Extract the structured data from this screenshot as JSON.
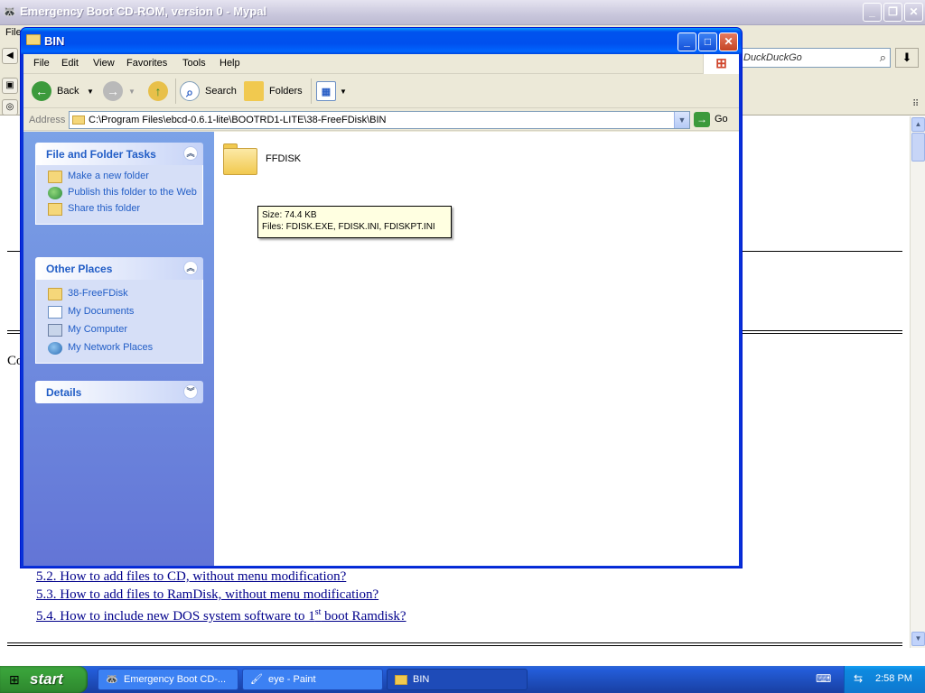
{
  "browser": {
    "title": "Emergency Boot CD-ROM, version 0 - Mypal",
    "menu_first": "File",
    "search_placeholder": "DuckDuckGo",
    "body_fragment": "Co",
    "toc_links": [
      {
        "text": "5.2. How to add files to CD, without menu modification?"
      },
      {
        "text": "5.3. How to add files to RamDisk, without menu modification?"
      },
      {
        "text_before": "5.4. How to include new DOS system software to 1",
        "sup": "st",
        "text_after": " boot Ramdisk?"
      }
    ]
  },
  "explorer": {
    "title": "BIN",
    "menu": [
      "File",
      "Edit",
      "View",
      "Favorites",
      "Tools",
      "Help"
    ],
    "toolbar": {
      "back_label": "Back",
      "search_label": "Search",
      "folders_label": "Folders"
    },
    "address": {
      "label": "Address",
      "path": "C:\\Program Files\\ebcd-0.6.1-lite\\BOOTRD1-LITE\\38-FreeFDisk\\BIN",
      "go_label": "Go"
    },
    "tasks_panel": {
      "title": "File and Folder Tasks",
      "items": [
        "Make a new folder",
        "Publish this folder to the Web",
        "Share this folder"
      ]
    },
    "places_panel": {
      "title": "Other Places",
      "items": [
        "38-FreeFDisk",
        "My Documents",
        "My Computer",
        "My Network Places"
      ]
    },
    "details_panel": {
      "title": "Details"
    },
    "files": [
      {
        "name": "FFDISK"
      }
    ],
    "tooltip": {
      "line1": "Size: 74.4 KB",
      "line2": "Files: FDISK.EXE, FDISK.INI, FDISKPT.INI"
    }
  },
  "taskbar": {
    "start_label": "start",
    "tasks": [
      {
        "label": "Emergency Boot CD-..."
      },
      {
        "label": "eye - Paint"
      },
      {
        "label": "BIN"
      }
    ],
    "clock": "2:58 PM"
  }
}
